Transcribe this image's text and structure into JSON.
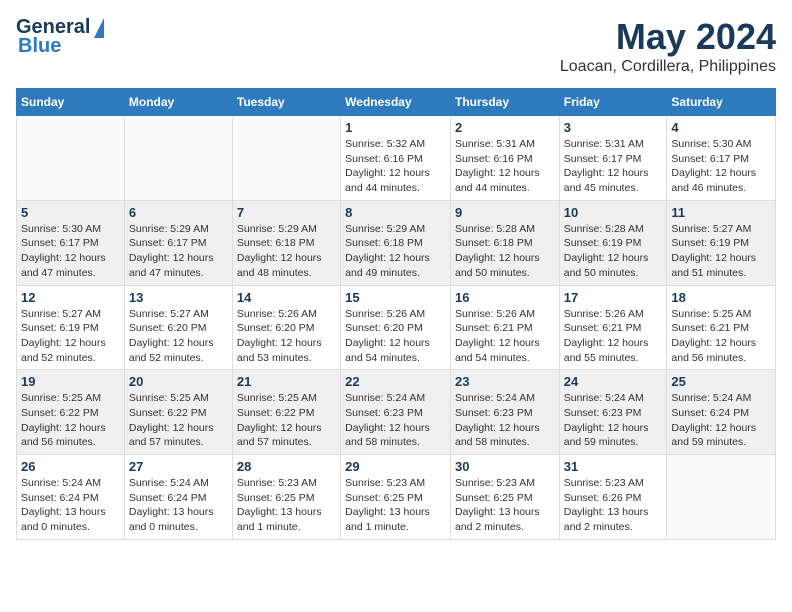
{
  "logo": {
    "line1": "General",
    "line2": "Blue"
  },
  "title": "May 2024",
  "location": "Loacan, Cordillera, Philippines",
  "headers": [
    "Sunday",
    "Monday",
    "Tuesday",
    "Wednesday",
    "Thursday",
    "Friday",
    "Saturday"
  ],
  "weeks": [
    {
      "group": 1,
      "days": [
        {
          "num": "",
          "info": ""
        },
        {
          "num": "",
          "info": ""
        },
        {
          "num": "",
          "info": ""
        },
        {
          "num": "1",
          "info": "Sunrise: 5:32 AM\nSunset: 6:16 PM\nDaylight: 12 hours\nand 44 minutes."
        },
        {
          "num": "2",
          "info": "Sunrise: 5:31 AM\nSunset: 6:16 PM\nDaylight: 12 hours\nand 44 minutes."
        },
        {
          "num": "3",
          "info": "Sunrise: 5:31 AM\nSunset: 6:17 PM\nDaylight: 12 hours\nand 45 minutes."
        },
        {
          "num": "4",
          "info": "Sunrise: 5:30 AM\nSunset: 6:17 PM\nDaylight: 12 hours\nand 46 minutes."
        }
      ]
    },
    {
      "group": 2,
      "days": [
        {
          "num": "5",
          "info": "Sunrise: 5:30 AM\nSunset: 6:17 PM\nDaylight: 12 hours\nand 47 minutes."
        },
        {
          "num": "6",
          "info": "Sunrise: 5:29 AM\nSunset: 6:17 PM\nDaylight: 12 hours\nand 47 minutes."
        },
        {
          "num": "7",
          "info": "Sunrise: 5:29 AM\nSunset: 6:18 PM\nDaylight: 12 hours\nand 48 minutes."
        },
        {
          "num": "8",
          "info": "Sunrise: 5:29 AM\nSunset: 6:18 PM\nDaylight: 12 hours\nand 49 minutes."
        },
        {
          "num": "9",
          "info": "Sunrise: 5:28 AM\nSunset: 6:18 PM\nDaylight: 12 hours\nand 50 minutes."
        },
        {
          "num": "10",
          "info": "Sunrise: 5:28 AM\nSunset: 6:19 PM\nDaylight: 12 hours\nand 50 minutes."
        },
        {
          "num": "11",
          "info": "Sunrise: 5:27 AM\nSunset: 6:19 PM\nDaylight: 12 hours\nand 51 minutes."
        }
      ]
    },
    {
      "group": 3,
      "days": [
        {
          "num": "12",
          "info": "Sunrise: 5:27 AM\nSunset: 6:19 PM\nDaylight: 12 hours\nand 52 minutes."
        },
        {
          "num": "13",
          "info": "Sunrise: 5:27 AM\nSunset: 6:20 PM\nDaylight: 12 hours\nand 52 minutes."
        },
        {
          "num": "14",
          "info": "Sunrise: 5:26 AM\nSunset: 6:20 PM\nDaylight: 12 hours\nand 53 minutes."
        },
        {
          "num": "15",
          "info": "Sunrise: 5:26 AM\nSunset: 6:20 PM\nDaylight: 12 hours\nand 54 minutes."
        },
        {
          "num": "16",
          "info": "Sunrise: 5:26 AM\nSunset: 6:21 PM\nDaylight: 12 hours\nand 54 minutes."
        },
        {
          "num": "17",
          "info": "Sunrise: 5:26 AM\nSunset: 6:21 PM\nDaylight: 12 hours\nand 55 minutes."
        },
        {
          "num": "18",
          "info": "Sunrise: 5:25 AM\nSunset: 6:21 PM\nDaylight: 12 hours\nand 56 minutes."
        }
      ]
    },
    {
      "group": 4,
      "days": [
        {
          "num": "19",
          "info": "Sunrise: 5:25 AM\nSunset: 6:22 PM\nDaylight: 12 hours\nand 56 minutes."
        },
        {
          "num": "20",
          "info": "Sunrise: 5:25 AM\nSunset: 6:22 PM\nDaylight: 12 hours\nand 57 minutes."
        },
        {
          "num": "21",
          "info": "Sunrise: 5:25 AM\nSunset: 6:22 PM\nDaylight: 12 hours\nand 57 minutes."
        },
        {
          "num": "22",
          "info": "Sunrise: 5:24 AM\nSunset: 6:23 PM\nDaylight: 12 hours\nand 58 minutes."
        },
        {
          "num": "23",
          "info": "Sunrise: 5:24 AM\nSunset: 6:23 PM\nDaylight: 12 hours\nand 58 minutes."
        },
        {
          "num": "24",
          "info": "Sunrise: 5:24 AM\nSunset: 6:23 PM\nDaylight: 12 hours\nand 59 minutes."
        },
        {
          "num": "25",
          "info": "Sunrise: 5:24 AM\nSunset: 6:24 PM\nDaylight: 12 hours\nand 59 minutes."
        }
      ]
    },
    {
      "group": 5,
      "days": [
        {
          "num": "26",
          "info": "Sunrise: 5:24 AM\nSunset: 6:24 PM\nDaylight: 13 hours\nand 0 minutes."
        },
        {
          "num": "27",
          "info": "Sunrise: 5:24 AM\nSunset: 6:24 PM\nDaylight: 13 hours\nand 0 minutes."
        },
        {
          "num": "28",
          "info": "Sunrise: 5:23 AM\nSunset: 6:25 PM\nDaylight: 13 hours\nand 1 minute."
        },
        {
          "num": "29",
          "info": "Sunrise: 5:23 AM\nSunset: 6:25 PM\nDaylight: 13 hours\nand 1 minute."
        },
        {
          "num": "30",
          "info": "Sunrise: 5:23 AM\nSunset: 6:25 PM\nDaylight: 13 hours\nand 2 minutes."
        },
        {
          "num": "31",
          "info": "Sunrise: 5:23 AM\nSunset: 6:26 PM\nDaylight: 13 hours\nand 2 minutes."
        },
        {
          "num": "",
          "info": ""
        }
      ]
    }
  ]
}
